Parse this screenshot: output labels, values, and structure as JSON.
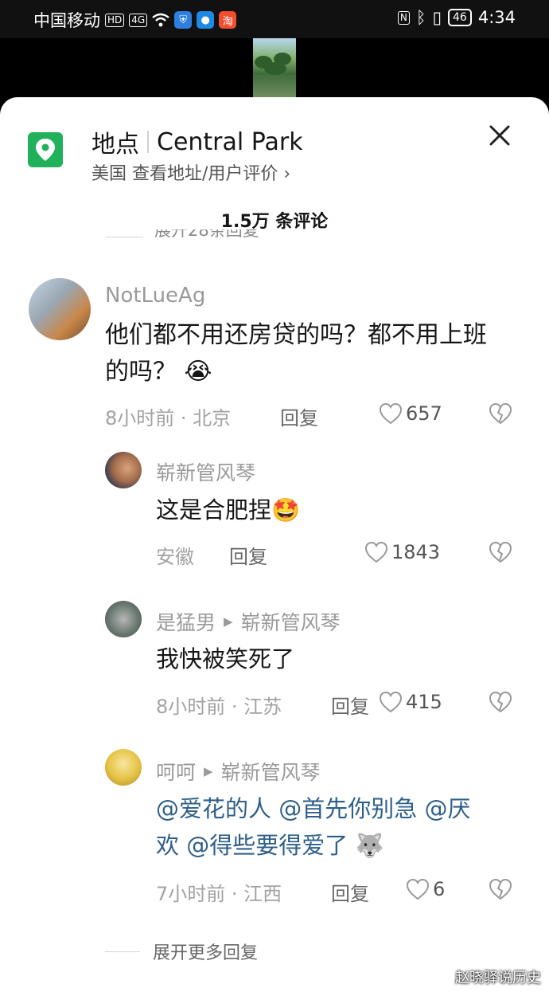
{
  "status_bar": {
    "carrier": "中国移动",
    "hd": "HD",
    "signal": "4G",
    "app_label": "淘",
    "battery": "46",
    "time": "4:34"
  },
  "location": {
    "label": "地点",
    "name": "Central Park",
    "subtitle": "美国  查看地址/用户评价",
    "chevron": "›"
  },
  "comments_count": "1.5万 条评论",
  "partial_expand": "展开28条回复",
  "comments": [
    {
      "user": "NotLueAg",
      "text_line1": "他们都不用还房贷的吗？都不用上班",
      "text_line2": "的吗？",
      "emoji": "😭",
      "meta": "8小时前 · 北京",
      "reply": "回复",
      "likes": "657"
    },
    {
      "user": "崭新管风琴",
      "text": "这是合肥捏",
      "emoji": "🤩",
      "meta": "安徽",
      "reply": "回复",
      "likes": "1843"
    },
    {
      "user": "是猛男",
      "reply_to": "崭新管风琴",
      "text": "我快被笑死了",
      "meta": "8小时前 · 江苏",
      "reply": "回复",
      "likes": "415"
    },
    {
      "user": "呵呵",
      "reply_to": "崭新管风琴",
      "mentions_line1": [
        "@爱花的人",
        "@首先你别急",
        "@厌"
      ],
      "mentions_line2": [
        "欢",
        "@得些要得爱了"
      ],
      "emoji": "🐺",
      "meta": "7小时前 · 江西",
      "reply": "回复",
      "likes": "6"
    }
  ],
  "expand_more": "展开更多回复",
  "watermark": "赵晓驿说历史",
  "colors": {
    "accent_green": "#20b15a",
    "mention_blue": "#2e5f8a",
    "muted_text": "#9a9a9a"
  },
  "icons": [
    "location-pin-icon",
    "close-icon",
    "heart-icon",
    "broken-heart-icon",
    "chevron-right-icon",
    "reply-arrow-icon"
  ]
}
